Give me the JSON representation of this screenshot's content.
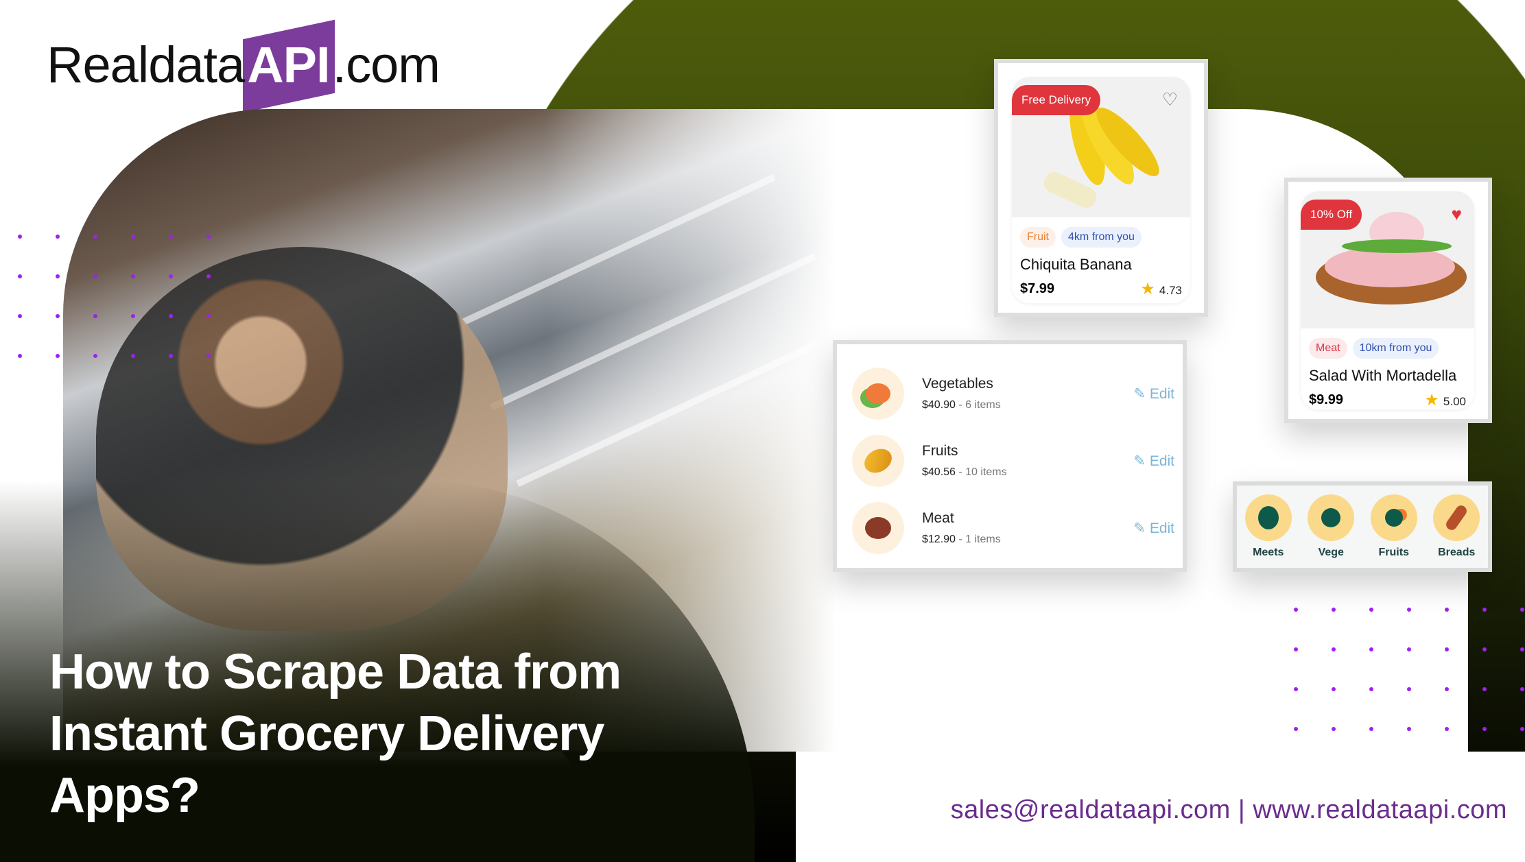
{
  "brand": {
    "logo_prefix": "Realdata",
    "logo_api": "API",
    "logo_suffix": ".com"
  },
  "headline": {
    "lines": [
      "How to Scrape Data from",
      "Instant Grocery Delivery",
      "Apps?"
    ]
  },
  "contact": "sales@realdataapi.com | www.realdataapi.com",
  "colors": {
    "accent": "#7b3c9c",
    "olive": "#4d5c0b",
    "badge_red": "#e0353c",
    "dots": "#a020f0"
  },
  "product_cards": [
    {
      "badge": "Free Delivery",
      "tag": "Fruit",
      "distance": "4km from you",
      "name": "Chiquita Banana",
      "price": "$7.99",
      "rating": "4.73",
      "favorited": false
    },
    {
      "badge": "10% Off",
      "tag": "Meat",
      "distance": "10km from you",
      "name": "Salad With Mortadella",
      "price": "$9.99",
      "rating": "5.00",
      "favorited": true
    }
  ],
  "cart_list": [
    {
      "name": "Vegetables",
      "price": "$40.90",
      "count": "6 items",
      "edit": "Edit"
    },
    {
      "name": "Fruits",
      "price": "$40.56",
      "count": "10 items",
      "edit": "Edit"
    },
    {
      "name": "Meat",
      "price": "$12.90",
      "count": "1 items",
      "edit": "Edit"
    }
  ],
  "categories": [
    {
      "label": "Meets"
    },
    {
      "label": "Vege"
    },
    {
      "label": "Fruits"
    },
    {
      "label": "Breads"
    }
  ]
}
